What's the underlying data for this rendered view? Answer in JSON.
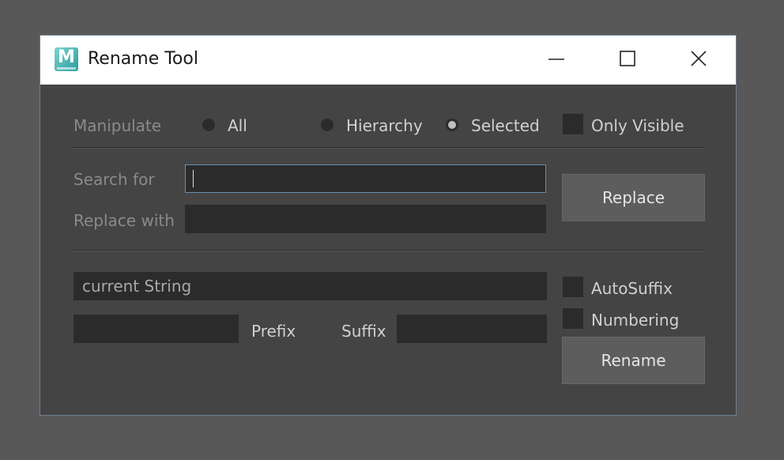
{
  "window": {
    "title": "Rename Tool",
    "app_icon_letter": "M"
  },
  "manipulate": {
    "label": "Manipulate",
    "options": [
      {
        "label": "All",
        "checked": false
      },
      {
        "label": "Hierarchy",
        "checked": false
      },
      {
        "label": "Selected",
        "checked": true
      }
    ],
    "only_visible": {
      "label": "Only Visible",
      "checked": false
    }
  },
  "search_replace": {
    "search_label": "Search for",
    "search_value": "",
    "replace_label": "Replace with",
    "replace_value": "",
    "replace_button": "Replace"
  },
  "rename": {
    "current_string": "current String",
    "prefix_value": "",
    "prefix_label": "Prefix",
    "suffix_label": "Suffix",
    "suffix_value": "",
    "autosuffix": {
      "label": "AutoSuffix",
      "checked": false
    },
    "numbering": {
      "label": "Numbering",
      "checked": false
    },
    "rename_button": "Rename"
  },
  "colors": {
    "background": "#585858",
    "panel": "#444444",
    "field": "#2b2b2b",
    "button": "#5d5d5d",
    "focus_border": "#6a8fb0"
  },
  "icons": {
    "app": "maya-app-icon",
    "minimize": "minimize-icon",
    "maximize": "maximize-icon",
    "close": "close-icon"
  }
}
